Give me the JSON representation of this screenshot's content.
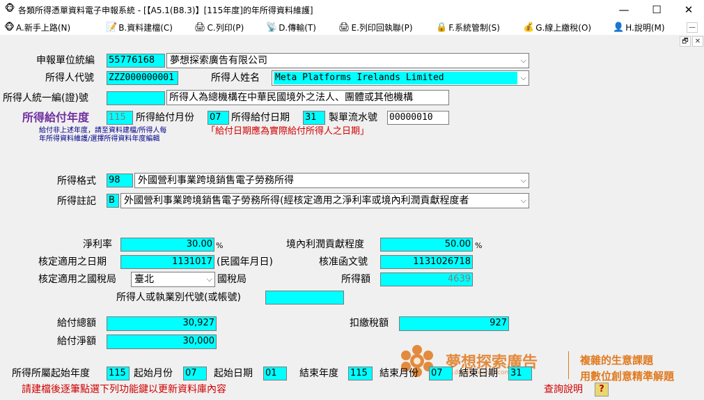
{
  "window": {
    "title": "各類所得憑單資料電子申報系統 - [【A5.1(B8.3)】[115年度]的年所得資料維護]",
    "minimize": "—",
    "maximize": "☐",
    "close": "✕"
  },
  "menu": {
    "items": [
      {
        "label": "A.新手上路(N)",
        "icon": "🐵"
      },
      {
        "label": "B.資料建檔(C)",
        "icon": "📝"
      },
      {
        "label": "C.列印(P)",
        "icon": "🖨"
      },
      {
        "label": "D.傳輸(T)",
        "icon": "📡"
      },
      {
        "label": "E.列印回執聯(P)",
        "icon": "🖨"
      },
      {
        "label": "F.系統管制(S)",
        "icon": "🔒"
      },
      {
        "label": "G.線上繳稅(O)",
        "icon": "💰"
      },
      {
        "label": "H.說明(M)",
        "icon": "👤"
      }
    ],
    "mdi_minimize": "—",
    "mdi_restore": "🗗",
    "mdi_close": "✕"
  },
  "form": {
    "unit_id_label": "申報單位統編",
    "unit_id_value": "55776168",
    "unit_name_value": "夢想探索廣告有限公司",
    "payee_code_label": "所得人代號",
    "payee_code_value": "ZZZ000000001",
    "payee_name_label": "所得人姓名",
    "payee_name_value": "Meta Platforms Irelands Limited",
    "payee_id_label": "所得人統一編(證)號",
    "payee_id_value": "",
    "payee_id_note": "所得人為總機構在中華民國境外之法人、團體或其他機構",
    "pay_year_label": "所得給付年度",
    "pay_year_value": "115",
    "pay_month_label": "所得給付月份",
    "pay_month_value": "07",
    "pay_day_label": "所得給付日期",
    "pay_day_value": "31",
    "serial_label": "製單流水號",
    "serial_value": "00000010",
    "note_line1": "給付非上述年度，請至資料建檔/所得人每",
    "note_line2": "年所得資料維護/選擇所得資料年度編輯",
    "note_red": "「給付日期應為實際給付所得人之日期」",
    "income_type_label": "所得格式",
    "income_type_code": "98",
    "income_type_text": "外國營利事業跨境銷售電子勞務所得",
    "income_note_label": "所得註記",
    "income_note_code": "B",
    "income_note_text": "外國營利事業跨境銷售電子勞務所得(經核定適用之淨利率或境內利潤貢獻程度者",
    "net_profit_label": "淨利率",
    "net_profit_value": "30.00",
    "pct1": "%",
    "contrib_label": "境內利潤貢獻程度",
    "contrib_value": "50.00",
    "pct2": "%",
    "approved_date_label": "核定適用之日期",
    "approved_date_value": "1131017",
    "approved_date_hint": "(民國年月日)",
    "approval_doc_label": "核准函文號",
    "approval_doc_value": "1131026718",
    "tax_bureau_label": "核定適用之國稅局",
    "tax_bureau_value": "臺北",
    "tax_bureau_suffix": "國稅局",
    "income_amount_label": "所得額",
    "income_amount_value": "4639",
    "business_code_label": "所得人或執業別代號(或帳號)",
    "business_code_value": "",
    "total_pay_label": "給付總額",
    "total_pay_value": "30,927",
    "withhold_label": "扣繳稅額",
    "withhold_value": "927",
    "net_pay_label": "給付淨額",
    "net_pay_value": "30,000",
    "start_year_label": "所得所屬起始年度",
    "start_year_value": "115",
    "start_month_label": "起始月份",
    "start_month_value": "07",
    "start_day_label": "起始日期",
    "start_day_value": "01",
    "end_year_label": "結束年度",
    "end_year_value": "115",
    "end_month_label": "結束月份",
    "end_month_value": "07",
    "end_day_label": "結束日期",
    "end_day_value": "31"
  },
  "footer": {
    "hint": "請建檔後逐筆點選下列功能鍵以更新資料庫內容",
    "help_label": "查詢說明",
    "help_button": "?"
  },
  "watermark": {
    "brand": "夢想探索廣告",
    "slogan1": "複雜的生意課題",
    "slogan2": "用數位創意精準解題",
    "url": "www.dreamsearch.com.tw"
  },
  "colors": {
    "field": "#00ffff",
    "year_label": "#7030a0",
    "note_blue": "#00008b",
    "note_red": "#d00000",
    "watermark_orange": "#e07a1f"
  }
}
